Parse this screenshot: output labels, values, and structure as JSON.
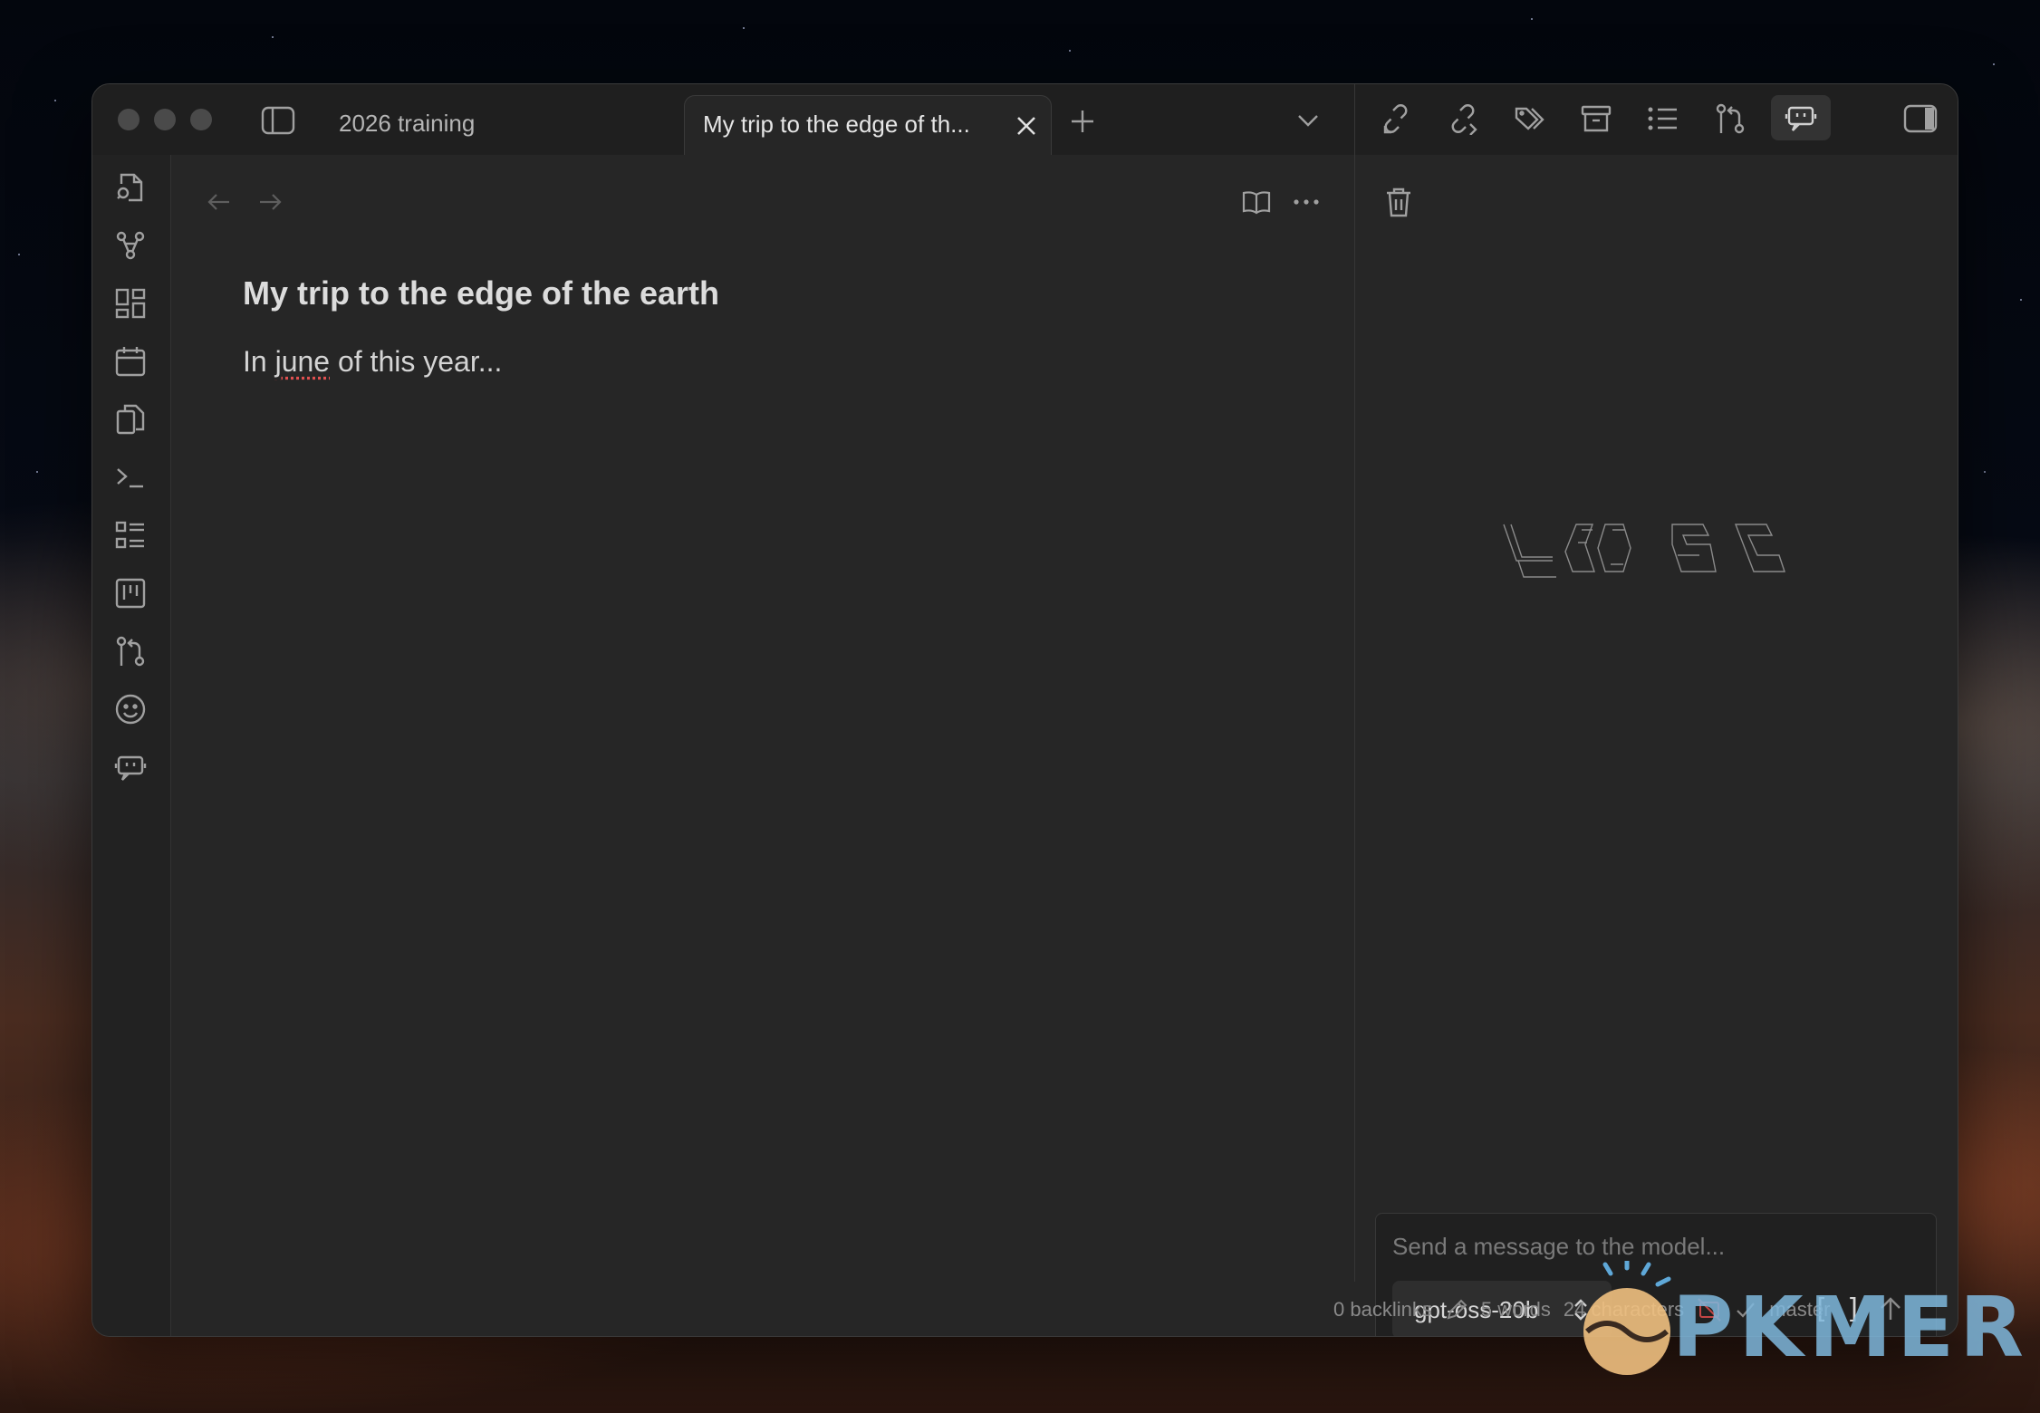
{
  "window": {
    "tabs": [
      {
        "label": "2026 training",
        "active": false
      },
      {
        "label": "My trip to the edge of th...",
        "active": true
      }
    ]
  },
  "ribbon": {
    "icons": [
      "quick-switcher-icon",
      "graph-view-icon",
      "canvas-icon",
      "daily-note-icon",
      "templates-icon",
      "command-palette-icon",
      "outline-list-icon",
      "kanban-icon",
      "git-branch-icon",
      "emoji-icon",
      "ai-chat-bot-icon"
    ]
  },
  "right_toolbar": {
    "icons": [
      "backlinks-icon",
      "outgoing-links-icon",
      "tags-icon",
      "archive-icon",
      "outline-icon",
      "git-icon",
      "bot-icon",
      "toggle-right-sidebar-icon"
    ]
  },
  "editor": {
    "title": "My trip to the edge of the earth",
    "body_prefix": "In ",
    "body_misspelled": "june",
    "body_suffix": " of this year..."
  },
  "chat": {
    "placeholder": "Send a message to the model...",
    "model": "gpt-oss-20b",
    "context_button": "[ ]"
  },
  "status_bar": {
    "backlinks": "0 backlinks",
    "words": "5 words",
    "characters": "24 characters",
    "branch": "master"
  },
  "watermark": {
    "text": "PKMER"
  }
}
